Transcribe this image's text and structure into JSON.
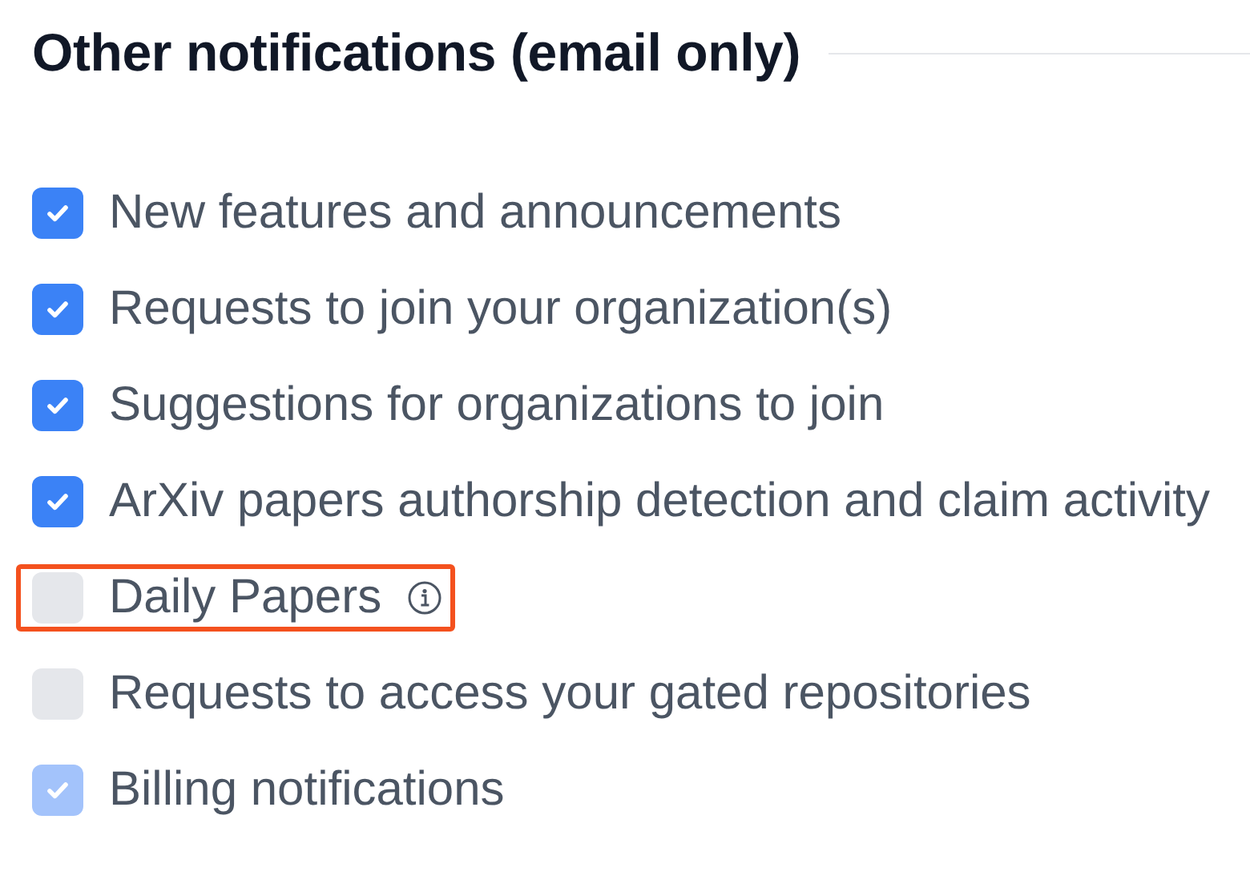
{
  "section": {
    "title": "Other notifications (email only)"
  },
  "options": [
    {
      "label": "New features and announcements",
      "checked": true,
      "disabled": false,
      "highlighted": false,
      "info": false
    },
    {
      "label": "Requests to join your organization(s)",
      "checked": true,
      "disabled": false,
      "highlighted": false,
      "info": false
    },
    {
      "label": "Suggestions for organizations to join",
      "checked": true,
      "disabled": false,
      "highlighted": false,
      "info": false
    },
    {
      "label": "ArXiv papers authorship detection and claim activity",
      "checked": true,
      "disabled": false,
      "highlighted": false,
      "info": false
    },
    {
      "label": "Daily Papers",
      "checked": false,
      "disabled": false,
      "highlighted": true,
      "info": true
    },
    {
      "label": "Requests to access your gated repositories",
      "checked": false,
      "disabled": false,
      "highlighted": false,
      "info": false
    },
    {
      "label": "Billing notifications",
      "checked": true,
      "disabled": true,
      "highlighted": false,
      "info": false
    }
  ]
}
